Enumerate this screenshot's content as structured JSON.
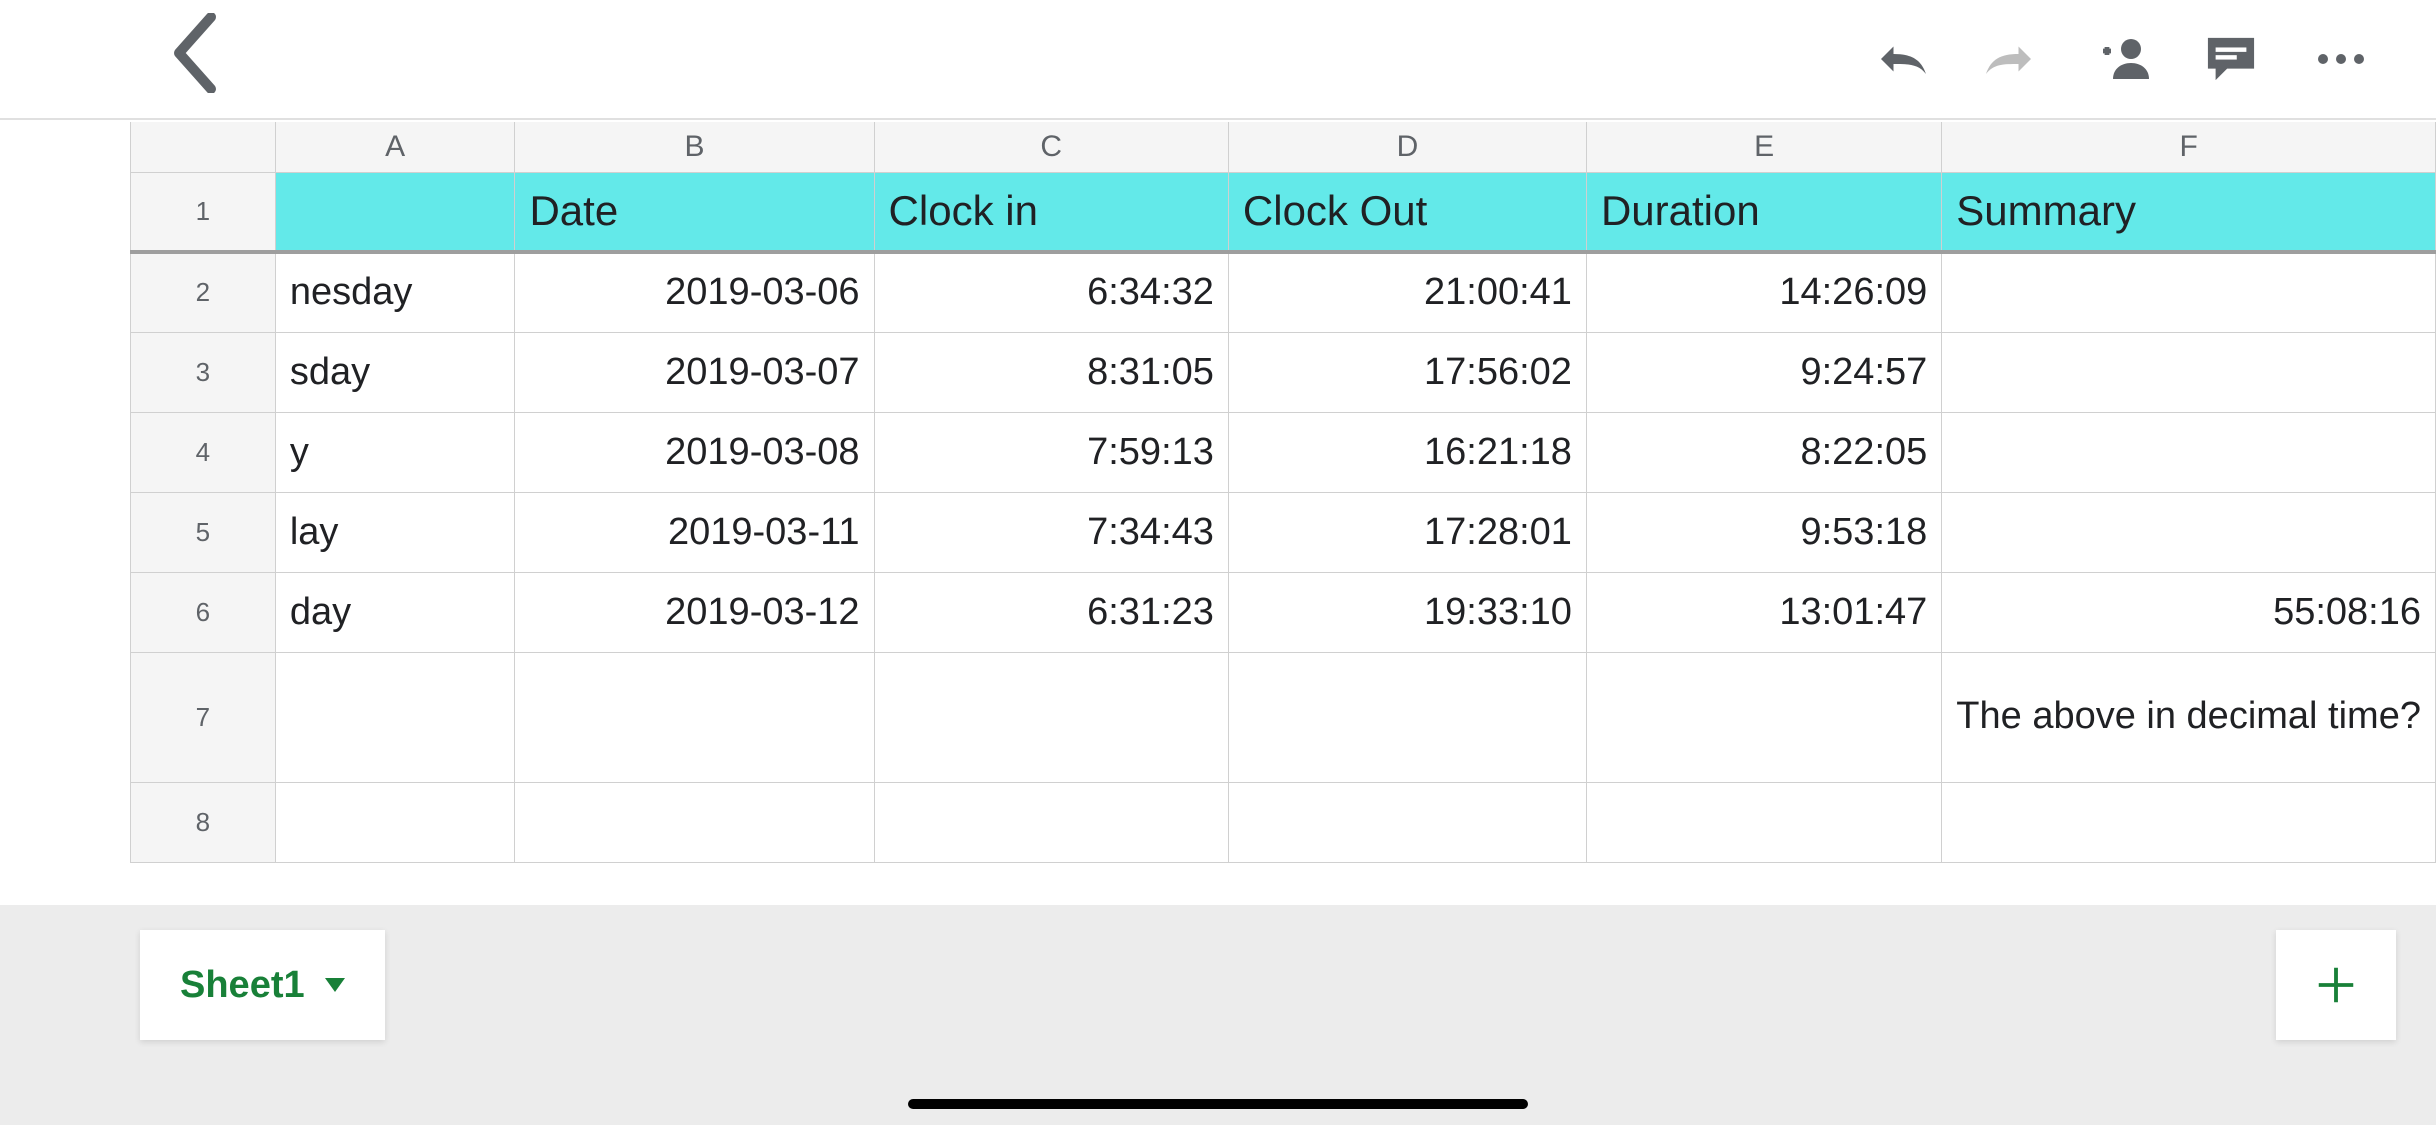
{
  "toolbar": {
    "back_label": "Back",
    "undo_label": "Undo",
    "redo_label": "Redo",
    "add_person_label": "Share",
    "comment_label": "Comment",
    "more_label": "More"
  },
  "columns": [
    "A",
    "B",
    "C",
    "D",
    "E",
    "F"
  ],
  "header_row": {
    "A": "",
    "B": "Date",
    "C": "Clock in",
    "D": "Clock Out",
    "E": "Duration",
    "F": "Summary"
  },
  "rows": [
    {
      "n": "2",
      "A": "nesday",
      "B": "2019-03-06",
      "C": "6:34:32",
      "D": "21:00:41",
      "E": "14:26:09",
      "F": ""
    },
    {
      "n": "3",
      "A": "sday",
      "B": "2019-03-07",
      "C": "8:31:05",
      "D": "17:56:02",
      "E": "9:24:57",
      "F": ""
    },
    {
      "n": "4",
      "A": "y",
      "B": "2019-03-08",
      "C": "7:59:13",
      "D": "16:21:18",
      "E": "8:22:05",
      "F": ""
    },
    {
      "n": "5",
      "A": "lay",
      "B": "2019-03-11",
      "C": "7:34:43",
      "D": "17:28:01",
      "E": "9:53:18",
      "F": ""
    },
    {
      "n": "6",
      "A": "day",
      "B": "2019-03-12",
      "C": "6:31:23",
      "D": "19:33:10",
      "E": "13:01:47",
      "F": "55:08:16"
    }
  ],
  "row7": {
    "n": "7",
    "F": "The above in decimal time?"
  },
  "row8": {
    "n": "8"
  },
  "sheet_tab": {
    "name": "Sheet1"
  },
  "add_sheet_label": "Add sheet",
  "colors": {
    "header_bg": "#63E9E9",
    "accent": "#188038",
    "error": "#ff0000"
  }
}
